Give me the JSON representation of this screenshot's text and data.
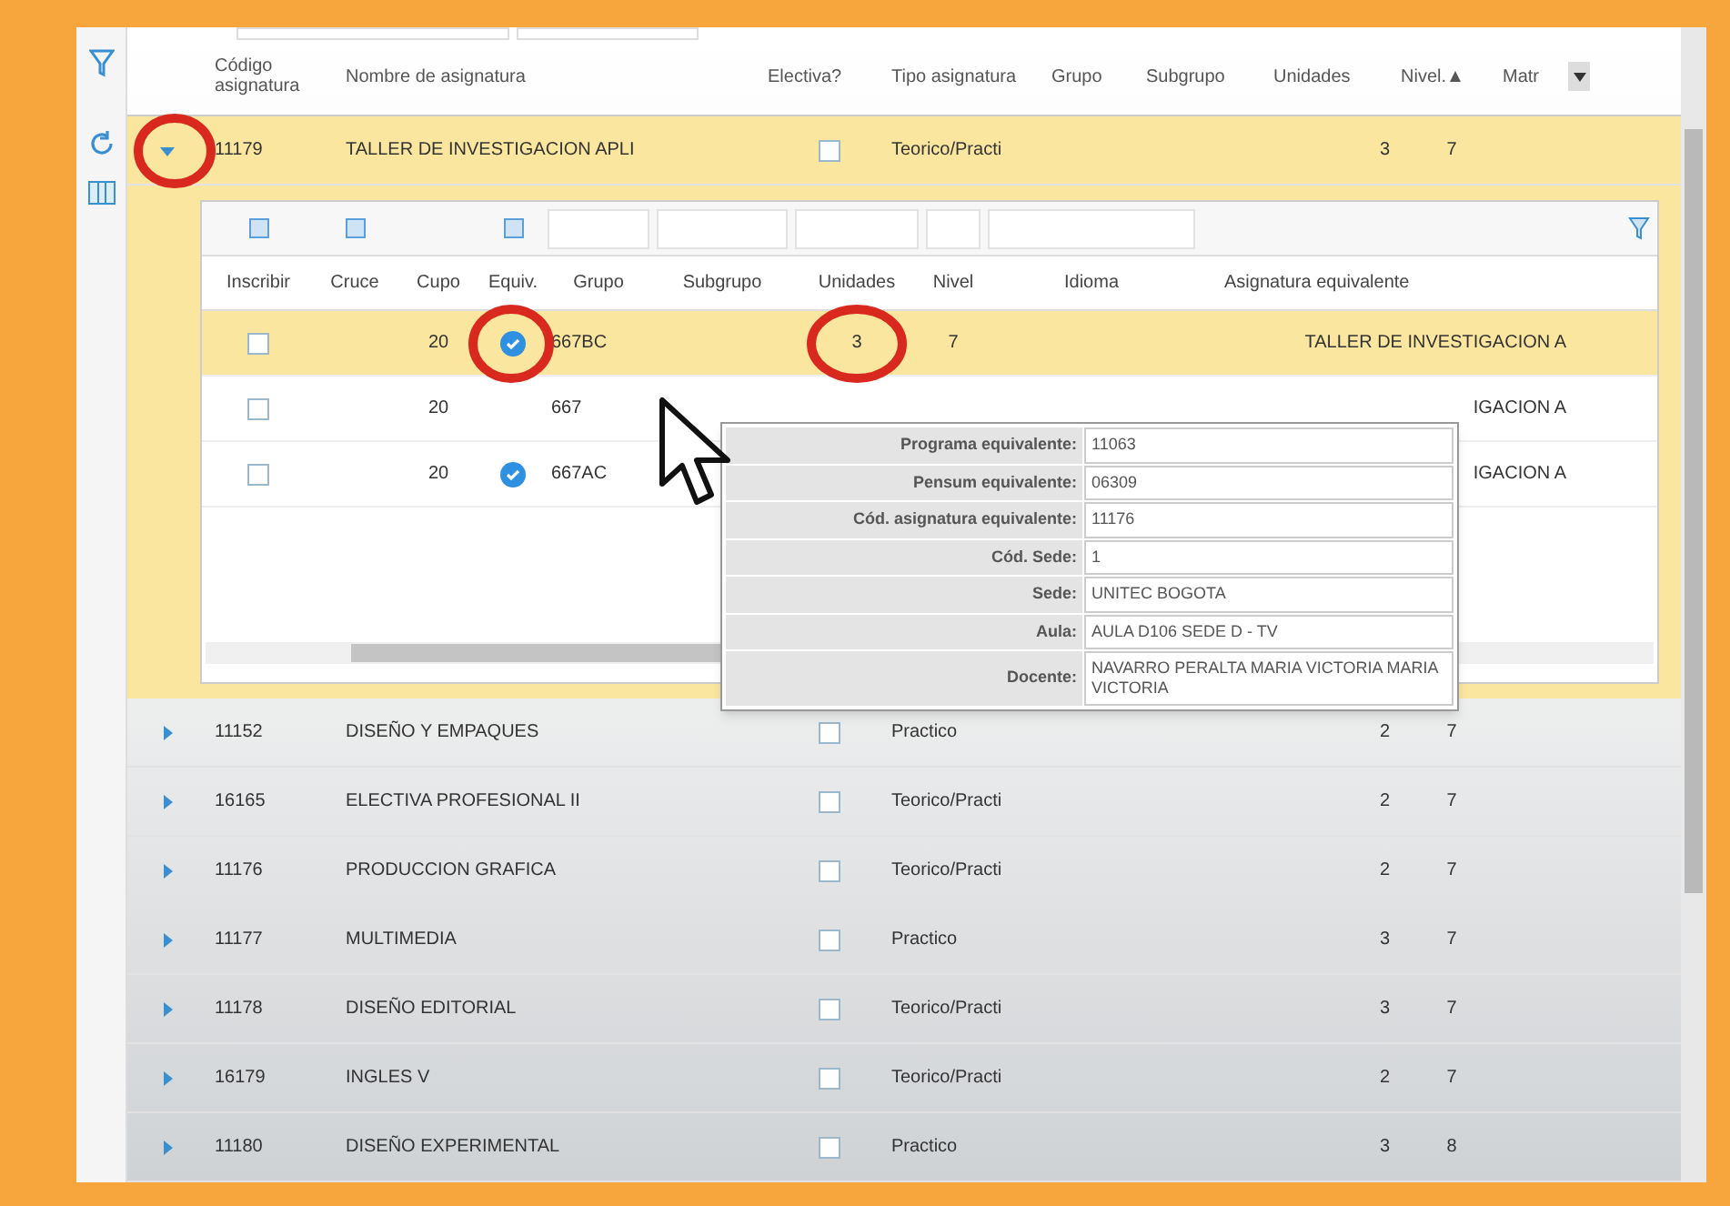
{
  "columns": [
    {
      "label": "Código asignatura"
    },
    {
      "label": "Nombre de asignatura"
    },
    {
      "label": "Electiva?"
    },
    {
      "label": "Tipo asignatura"
    },
    {
      "label": "Grupo"
    },
    {
      "label": "Subgrupo"
    },
    {
      "label": "Unidades"
    },
    {
      "label": "Nivel."
    },
    {
      "label": "Matr"
    }
  ],
  "rows": [
    {
      "code": "11179",
      "name": "TALLER DE INVESTIGACION APLI",
      "electiva": false,
      "tipo": "Teorico/Practi",
      "unidades": "3",
      "nivel": "7",
      "expanded": true,
      "selected": true
    },
    {
      "code": "11152",
      "name": "DISEÑO Y EMPAQUES",
      "electiva": false,
      "tipo": "Practico",
      "unidades": "2",
      "nivel": "7",
      "expanded": false,
      "selected": false
    },
    {
      "code": "16165",
      "name": "ELECTIVA PROFESIONAL II",
      "electiva": false,
      "tipo": "Teorico/Practi",
      "unidades": "2",
      "nivel": "7",
      "expanded": false,
      "selected": false
    },
    {
      "code": "11176",
      "name": "PRODUCCION GRAFICA",
      "electiva": false,
      "tipo": "Teorico/Practi",
      "unidades": "2",
      "nivel": "7",
      "expanded": false,
      "selected": false
    },
    {
      "code": "11177",
      "name": "MULTIMEDIA",
      "electiva": false,
      "tipo": "Practico",
      "unidades": "3",
      "nivel": "7",
      "expanded": false,
      "selected": false
    },
    {
      "code": "11178",
      "name": "DISEÑO EDITORIAL",
      "electiva": false,
      "tipo": "Teorico/Practi",
      "unidades": "3",
      "nivel": "7",
      "expanded": false,
      "selected": false
    },
    {
      "code": "16179",
      "name": "INGLES V",
      "electiva": false,
      "tipo": "Teorico/Practi",
      "unidades": "2",
      "nivel": "7",
      "expanded": false,
      "selected": false
    },
    {
      "code": "11180",
      "name": "DISEÑO EXPERIMENTAL",
      "electiva": false,
      "tipo": "Practico",
      "unidades": "3",
      "nivel": "8",
      "expanded": false,
      "selected": false
    }
  ],
  "subgrid": {
    "columns": [
      {
        "label": "Inscribir"
      },
      {
        "label": "Cruce"
      },
      {
        "label": "Cupo"
      },
      {
        "label": "Equiv."
      },
      {
        "label": "Grupo"
      },
      {
        "label": "Subgrupo"
      },
      {
        "label": "Unidades"
      },
      {
        "label": "Nivel"
      },
      {
        "label": "Idioma"
      },
      {
        "label": "Asignatura equivalente"
      }
    ],
    "rows": [
      {
        "inscribir": false,
        "cupo": "20",
        "equiv": true,
        "grupo": "667BC",
        "unidades": "3",
        "nivel": "7",
        "asignatura": "TALLER DE INVESTIGACION A",
        "selected": true
      },
      {
        "inscribir": false,
        "cupo": "20",
        "equiv": false,
        "grupo": "667",
        "asignatura": "IGACION A",
        "selected": false
      },
      {
        "inscribir": false,
        "cupo": "20",
        "equiv": true,
        "grupo": "667AC",
        "asignatura": "IGACION A",
        "selected": false
      }
    ]
  },
  "tooltip": [
    {
      "label": "Programa equivalente:",
      "value": "11063"
    },
    {
      "label": "Pensum equivalente:",
      "value": "06309"
    },
    {
      "label": "Cód. asignatura equivalente:",
      "value": "11176"
    },
    {
      "label": "Cód. Sede:",
      "value": "1"
    },
    {
      "label": "Sede:",
      "value": "UNITEC BOGOTA"
    },
    {
      "label": "Aula:",
      "value": "AULA D106 SEDE D - TV"
    },
    {
      "label": "Docente:",
      "value": "NAVARRO PERALTA MARIA VICTORIA MARIA VICTORIA"
    }
  ]
}
